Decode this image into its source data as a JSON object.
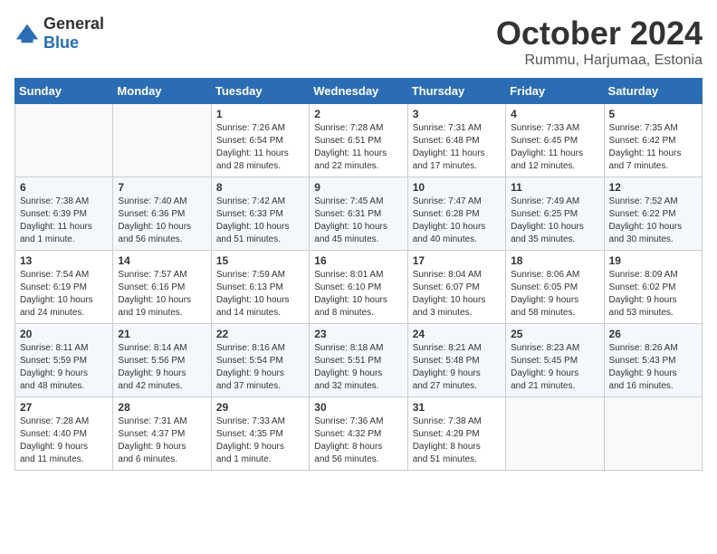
{
  "logo": {
    "general": "General",
    "blue": "Blue"
  },
  "title": "October 2024",
  "location": "Rummu, Harjumaa, Estonia",
  "days_of_week": [
    "Sunday",
    "Monday",
    "Tuesday",
    "Wednesday",
    "Thursday",
    "Friday",
    "Saturday"
  ],
  "weeks": [
    [
      {
        "day": "",
        "info": ""
      },
      {
        "day": "",
        "info": ""
      },
      {
        "day": "1",
        "info": "Sunrise: 7:26 AM\nSunset: 6:54 PM\nDaylight: 11 hours\nand 28 minutes."
      },
      {
        "day": "2",
        "info": "Sunrise: 7:28 AM\nSunset: 6:51 PM\nDaylight: 11 hours\nand 22 minutes."
      },
      {
        "day": "3",
        "info": "Sunrise: 7:31 AM\nSunset: 6:48 PM\nDaylight: 11 hours\nand 17 minutes."
      },
      {
        "day": "4",
        "info": "Sunrise: 7:33 AM\nSunset: 6:45 PM\nDaylight: 11 hours\nand 12 minutes."
      },
      {
        "day": "5",
        "info": "Sunrise: 7:35 AM\nSunset: 6:42 PM\nDaylight: 11 hours\nand 7 minutes."
      }
    ],
    [
      {
        "day": "6",
        "info": "Sunrise: 7:38 AM\nSunset: 6:39 PM\nDaylight: 11 hours\nand 1 minute."
      },
      {
        "day": "7",
        "info": "Sunrise: 7:40 AM\nSunset: 6:36 PM\nDaylight: 10 hours\nand 56 minutes."
      },
      {
        "day": "8",
        "info": "Sunrise: 7:42 AM\nSunset: 6:33 PM\nDaylight: 10 hours\nand 51 minutes."
      },
      {
        "day": "9",
        "info": "Sunrise: 7:45 AM\nSunset: 6:31 PM\nDaylight: 10 hours\nand 45 minutes."
      },
      {
        "day": "10",
        "info": "Sunrise: 7:47 AM\nSunset: 6:28 PM\nDaylight: 10 hours\nand 40 minutes."
      },
      {
        "day": "11",
        "info": "Sunrise: 7:49 AM\nSunset: 6:25 PM\nDaylight: 10 hours\nand 35 minutes."
      },
      {
        "day": "12",
        "info": "Sunrise: 7:52 AM\nSunset: 6:22 PM\nDaylight: 10 hours\nand 30 minutes."
      }
    ],
    [
      {
        "day": "13",
        "info": "Sunrise: 7:54 AM\nSunset: 6:19 PM\nDaylight: 10 hours\nand 24 minutes."
      },
      {
        "day": "14",
        "info": "Sunrise: 7:57 AM\nSunset: 6:16 PM\nDaylight: 10 hours\nand 19 minutes."
      },
      {
        "day": "15",
        "info": "Sunrise: 7:59 AM\nSunset: 6:13 PM\nDaylight: 10 hours\nand 14 minutes."
      },
      {
        "day": "16",
        "info": "Sunrise: 8:01 AM\nSunset: 6:10 PM\nDaylight: 10 hours\nand 8 minutes."
      },
      {
        "day": "17",
        "info": "Sunrise: 8:04 AM\nSunset: 6:07 PM\nDaylight: 10 hours\nand 3 minutes."
      },
      {
        "day": "18",
        "info": "Sunrise: 8:06 AM\nSunset: 6:05 PM\nDaylight: 9 hours\nand 58 minutes."
      },
      {
        "day": "19",
        "info": "Sunrise: 8:09 AM\nSunset: 6:02 PM\nDaylight: 9 hours\nand 53 minutes."
      }
    ],
    [
      {
        "day": "20",
        "info": "Sunrise: 8:11 AM\nSunset: 5:59 PM\nDaylight: 9 hours\nand 48 minutes."
      },
      {
        "day": "21",
        "info": "Sunrise: 8:14 AM\nSunset: 5:56 PM\nDaylight: 9 hours\nand 42 minutes."
      },
      {
        "day": "22",
        "info": "Sunrise: 8:16 AM\nSunset: 5:54 PM\nDaylight: 9 hours\nand 37 minutes."
      },
      {
        "day": "23",
        "info": "Sunrise: 8:18 AM\nSunset: 5:51 PM\nDaylight: 9 hours\nand 32 minutes."
      },
      {
        "day": "24",
        "info": "Sunrise: 8:21 AM\nSunset: 5:48 PM\nDaylight: 9 hours\nand 27 minutes."
      },
      {
        "day": "25",
        "info": "Sunrise: 8:23 AM\nSunset: 5:45 PM\nDaylight: 9 hours\nand 21 minutes."
      },
      {
        "day": "26",
        "info": "Sunrise: 8:26 AM\nSunset: 5:43 PM\nDaylight: 9 hours\nand 16 minutes."
      }
    ],
    [
      {
        "day": "27",
        "info": "Sunrise: 7:28 AM\nSunset: 4:40 PM\nDaylight: 9 hours\nand 11 minutes."
      },
      {
        "day": "28",
        "info": "Sunrise: 7:31 AM\nSunset: 4:37 PM\nDaylight: 9 hours\nand 6 minutes."
      },
      {
        "day": "29",
        "info": "Sunrise: 7:33 AM\nSunset: 4:35 PM\nDaylight: 9 hours\nand 1 minute."
      },
      {
        "day": "30",
        "info": "Sunrise: 7:36 AM\nSunset: 4:32 PM\nDaylight: 8 hours\nand 56 minutes."
      },
      {
        "day": "31",
        "info": "Sunrise: 7:38 AM\nSunset: 4:29 PM\nDaylight: 8 hours\nand 51 minutes."
      },
      {
        "day": "",
        "info": ""
      },
      {
        "day": "",
        "info": ""
      }
    ]
  ]
}
